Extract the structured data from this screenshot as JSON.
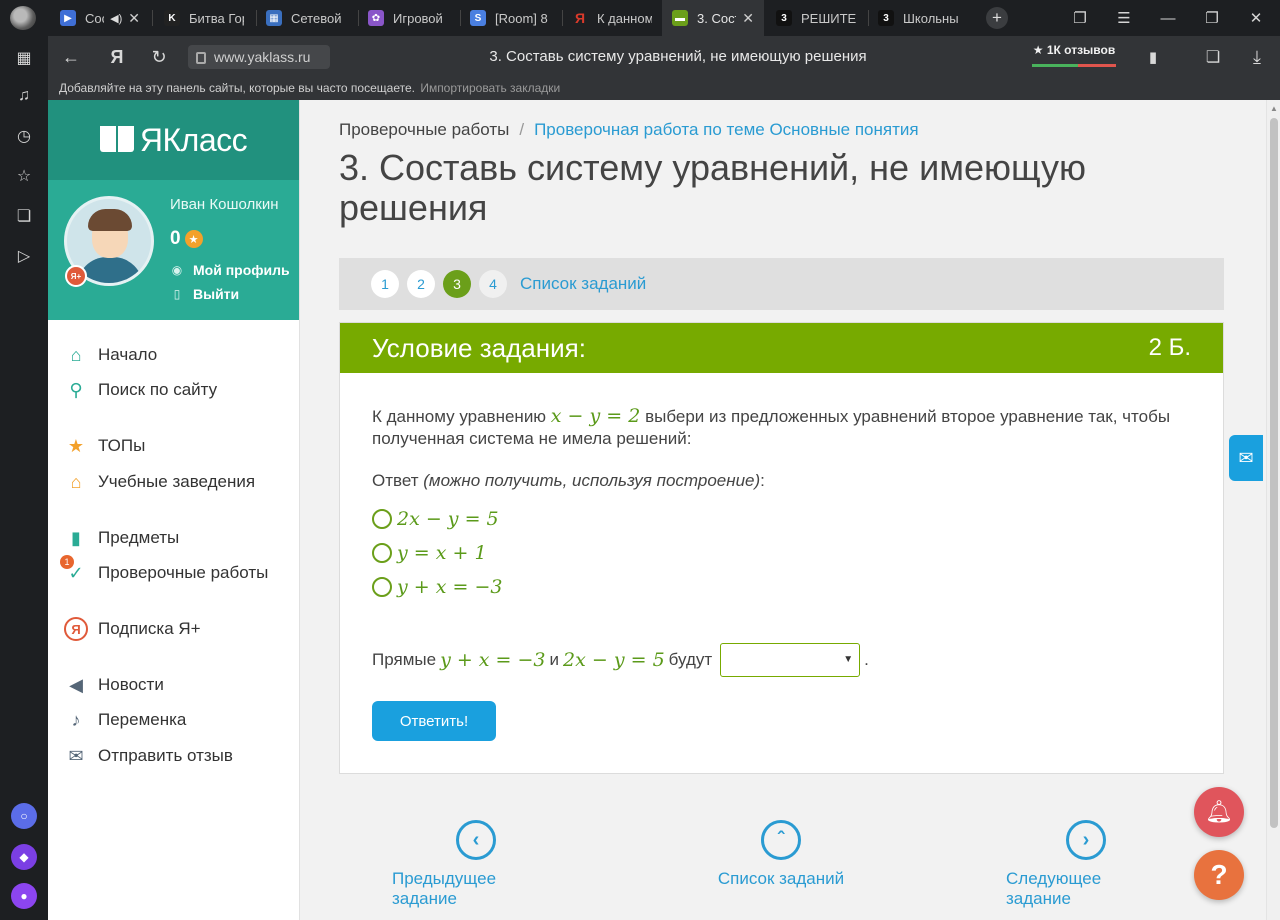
{
  "browser": {
    "tabs": [
      {
        "title": "Сос",
        "fav_color": "#3f6fd6",
        "fav_glyph": "▶",
        "icon": "video-icon"
      },
      {
        "title": "Битва Гор",
        "fav_color": "#222222",
        "fav_glyph": "K",
        "icon": "kinopoisk-icon"
      },
      {
        "title": "Сетевой",
        "fav_color": "#3a6fbf",
        "fav_glyph": "▦",
        "icon": "school-icon"
      },
      {
        "title": "Игровой",
        "fav_color": "#8a56c9",
        "fav_glyph": "✿",
        "icon": "game-icon"
      },
      {
        "title": "[Room] 8",
        "fav_color": "#4a7fe0",
        "fav_glyph": "S",
        "icon": "room-icon"
      },
      {
        "title": "К данном",
        "fav_color": "#d93a2b",
        "fav_glyph": "Я",
        "icon": "yandex-icon"
      },
      {
        "title": "3. Сост",
        "fav_color": "#6b9f1a",
        "fav_glyph": "▬",
        "icon": "yaklass-icon"
      },
      {
        "title": "РЕШИТЕ",
        "fav_color": "#111111",
        "fav_glyph": "3",
        "icon": "znanija-icon"
      },
      {
        "title": "Школьны",
        "fav_color": "#111111",
        "fav_glyph": "3",
        "icon": "znanija-icon"
      }
    ],
    "url": "www.yaklass.ru",
    "page_title": "3. Составь систему уравнений, не имеющую решения",
    "reviews": "★ 1К отзывов",
    "bookmarks_hint": "Добавляйте на эту панель сайты, которые вы часто посещаете.",
    "bookmarks_import": "Импортировать закладки"
  },
  "sidebar": {
    "brand": "ЯКласс",
    "user": {
      "name": "Иван Кошолкин",
      "score": "0",
      "badge": "Я+"
    },
    "profile_link": "Мой профиль",
    "logout_link": "Выйти",
    "menu": [
      {
        "label": "Начало",
        "icon": "home-icon",
        "glyph": "⌂",
        "color": "#2aab95"
      },
      {
        "label": "Поиск по сайту",
        "icon": "search-icon",
        "glyph": "⚲",
        "color": "#2aab95"
      },
      {
        "label": "ТОПы",
        "icon": "star-icon",
        "glyph": "★",
        "color": "#f3a12b"
      },
      {
        "label": "Учебные заведения",
        "icon": "school-building-icon",
        "glyph": "⌂",
        "color": "#f3a12b"
      },
      {
        "label": "Предметы",
        "icon": "book-icon",
        "glyph": "▮",
        "color": "#2aab95"
      },
      {
        "label": "Проверочные работы",
        "icon": "check-icon",
        "glyph": "✓",
        "color": "#2aab95",
        "count": "1"
      },
      {
        "label": "Подписка Я+",
        "icon": "subscription-icon",
        "glyph": "Я",
        "color": "#e05a3a"
      },
      {
        "label": "Новости",
        "icon": "megaphone-icon",
        "glyph": "◀",
        "color": "#556677"
      },
      {
        "label": "Переменка",
        "icon": "bell-icon",
        "glyph": "♪",
        "color": "#556677"
      },
      {
        "label": "Отправить отзыв",
        "icon": "feedback-icon",
        "glyph": "✉",
        "color": "#556677"
      }
    ]
  },
  "breadcrumb": {
    "root": "Проверочные работы",
    "sep": "/",
    "current": "Проверочная работа по теме Основные понятия"
  },
  "page_title": "3. Составь систему уравнений, не имеющую решения",
  "pager": {
    "pages": [
      "1",
      "2",
      "3",
      "4"
    ],
    "current_index": 2,
    "list_link": "Список заданий"
  },
  "task": {
    "header": "Условие задания:",
    "points": "2 Б.",
    "question_prefix": "К данному уравнению",
    "question_math": "x − y = 2",
    "question_suffix": "выбери из предложенных уравнений второе уравнение так, чтобы полученная система не имела решений:",
    "answer_label": "Ответ",
    "answer_hint": "(можно получить, используя построение)",
    "answer_colon": ":",
    "options": [
      "2x − y = 5",
      "y = x + 1",
      "y + x = −3"
    ],
    "lines_prefix": "Прямые",
    "lines_eq1": "y + x = −3",
    "lines_and": "и",
    "lines_eq2": "2x − y = 5",
    "lines_suffix": "будут",
    "select_value": "",
    "dot": ".",
    "submit": "Ответить!"
  },
  "bottom_nav": {
    "prev": "Предыдущее задание",
    "list": "Список заданий",
    "next": "Следующее задание"
  },
  "colors": {
    "brand_green": "#21917e",
    "profile_green": "#2aab95",
    "task_header": "#77aa00",
    "link_blue": "#2a9bd2",
    "button_blue": "#1aa0de"
  }
}
